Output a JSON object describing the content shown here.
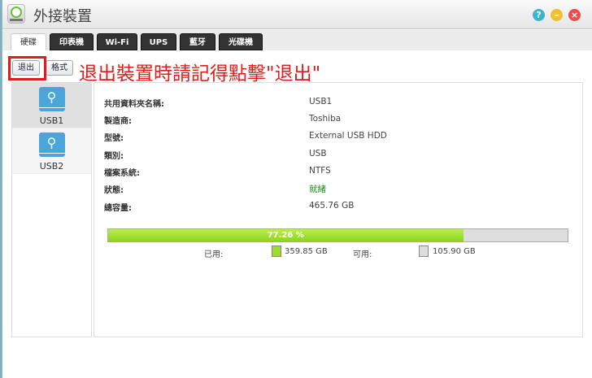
{
  "window": {
    "title": "外接裝置"
  },
  "controls": {
    "help": "?",
    "minimize": "–",
    "close": "×"
  },
  "tabs": [
    {
      "label": "硬碟"
    },
    {
      "label": "印表機"
    },
    {
      "label": "Wi-Fi"
    },
    {
      "label": "UPS"
    },
    {
      "label": "藍牙"
    },
    {
      "label": "光碟機"
    }
  ],
  "toolbar": {
    "eject": "退出",
    "format": "格式"
  },
  "annotation": "退出裝置時請記得點擊\"退出\"",
  "devices": [
    {
      "label": "USB1"
    },
    {
      "label": "USB2"
    }
  ],
  "details": [
    {
      "label": "共用資料夾名稱:",
      "value": "USB1"
    },
    {
      "label": "製造商:",
      "value": "Toshiba"
    },
    {
      "label": "型號:",
      "value": "External USB HDD"
    },
    {
      "label": "類別:",
      "value": "USB"
    },
    {
      "label": "檔案系統:",
      "value": "NTFS"
    },
    {
      "label": "狀態:",
      "value": "就緒"
    },
    {
      "label": "總容量:",
      "value": "465.76 GB"
    }
  ],
  "usage": {
    "percent_text": "77.26 %",
    "percent": 77.26,
    "used_label": "已用:",
    "used": "359.85 GB",
    "free_label": "可用:",
    "free": "105.90 GB"
  },
  "colors": {
    "used": "#9bdc2c",
    "free": "#dddddd",
    "status_ok": "#1a8a1a",
    "annotation": "#e21b1b"
  }
}
